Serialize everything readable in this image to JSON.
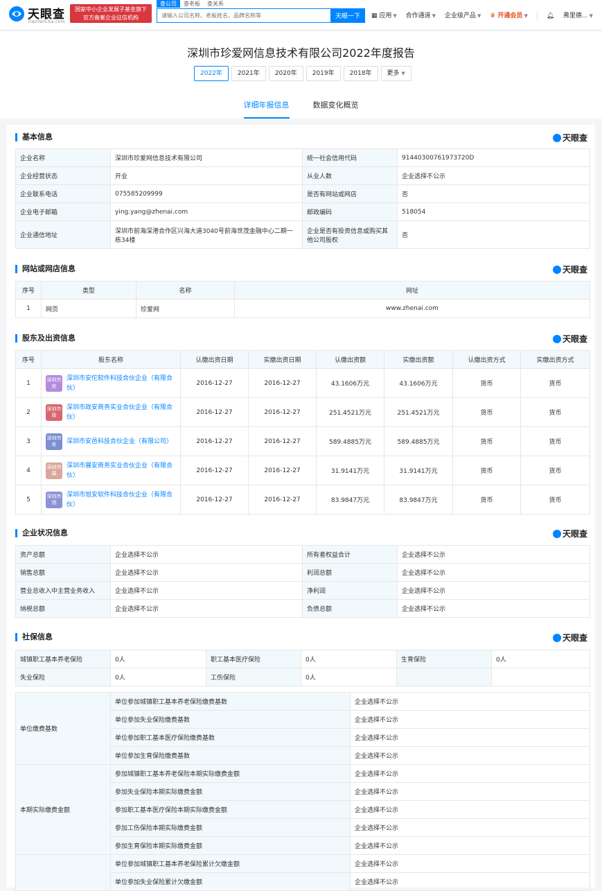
{
  "header": {
    "logo_text": "天眼查",
    "logo_sub": "TianYanCha.com",
    "badge_line1": "国家中小企业发展子基金旗下",
    "badge_line2": "官方备案企业征信机构",
    "tabs": [
      "查公司",
      "查老板",
      "查关系"
    ],
    "search_placeholder": "请输入公司名称、老板姓名、品牌名称等",
    "search_button": "天眼一下",
    "nav": [
      "应用",
      "合作通道",
      "企业级产品",
      "开通会员",
      "弗里德..."
    ]
  },
  "title": "深圳市珍爱网信息技术有限公司2022年度报告",
  "years": [
    "2022年",
    "2021年",
    "2020年",
    "2019年",
    "2018年",
    "更多"
  ],
  "subtabs": [
    "详细年报信息",
    "数据变化概览"
  ],
  "brand": "天眼查",
  "basic": {
    "title": "基本信息",
    "rows": [
      [
        "企业名称",
        "深圳市珍爱网信息技术有限公司",
        "统一社会信用代码",
        "91440300761973720D"
      ],
      [
        "企业经营状态",
        "开业",
        "从业人数",
        "企业选择不公示"
      ],
      [
        "企业联系电话",
        "075585209999",
        "是否有网站或网店",
        "否"
      ],
      [
        "企业电子邮箱",
        "ying.yang@zhenai.com",
        "邮政编码",
        "518054"
      ],
      [
        "企业通信地址",
        "深圳市前海深港合作区兴海大道3040号前海世茂金融中心二期一栋34楼",
        "企业是否有投资信息或购买其他公司股权",
        "否"
      ]
    ]
  },
  "website": {
    "title": "网站或网店信息",
    "headers": [
      "序号",
      "类型",
      "名称",
      "网址"
    ],
    "rows": [
      [
        "1",
        "网页",
        "珍爱网",
        "www.zhenai.com"
      ]
    ]
  },
  "shareholders": {
    "title": "股东及出资信息",
    "headers": [
      "序号",
      "股东名称",
      "认缴出资日期",
      "实缴出资日期",
      "认缴出资额",
      "实缴出资额",
      "认缴出资方式",
      "实缴出资方式"
    ],
    "rows": [
      {
        "no": "1",
        "avatar": "深圳市安",
        "avatar_color": "#b58be0",
        "name": "深圳市安佗软件科技合伙企业（有限合伙）",
        "d1": "2016-12-27",
        "d2": "2016-12-27",
        "a1": "43.1606万元",
        "a2": "43.1606万元",
        "m1": "货币",
        "m2": "货币"
      },
      {
        "no": "2",
        "avatar": "深圳市政",
        "avatar_color": "#d9666e",
        "name": "深圳市政安商务实业合伙企业（有限合伙）",
        "d1": "2016-12-27",
        "d2": "2016-12-27",
        "a1": "251.4521万元",
        "a2": "251.4521万元",
        "m1": "货币",
        "m2": "货币"
      },
      {
        "no": "3",
        "avatar": "深圳市安",
        "avatar_color": "#7b8fd1",
        "name": "深圳市安邑科技合伙企业（有限公司）",
        "d1": "2016-12-27",
        "d2": "2016-12-27",
        "a1": "589.4885万元",
        "a2": "589.4885万元",
        "m1": "货币",
        "m2": "货币"
      },
      {
        "no": "4",
        "avatar": "深圳市展",
        "avatar_color": "#d9a89a",
        "name": "深圳市展安商务实业合伙企业（有限合伙）",
        "d1": "2016-12-27",
        "d2": "2016-12-27",
        "a1": "31.9141万元",
        "a2": "31.9141万元",
        "m1": "货币",
        "m2": "货币"
      },
      {
        "no": "5",
        "avatar": "深圳市旭",
        "avatar_color": "#8b93d6",
        "name": "深圳市旭安软件科技合伙企业（有限合伙）",
        "d1": "2016-12-27",
        "d2": "2016-12-27",
        "a1": "83.9847万元",
        "a2": "83.9847万元",
        "m1": "货币",
        "m2": "货币"
      }
    ]
  },
  "status": {
    "title": "企业状况信息",
    "rows": [
      [
        "资产总额",
        "企业选择不公示",
        "所有者权益合计",
        "企业选择不公示"
      ],
      [
        "销售总额",
        "企业选择不公示",
        "利润总额",
        "企业选择不公示"
      ],
      [
        "营业总收入中主营业务收入",
        "企业选择不公示",
        "净利润",
        "企业选择不公示"
      ],
      [
        "纳税总额",
        "企业选择不公示",
        "负债总额",
        "企业选择不公示"
      ]
    ]
  },
  "social": {
    "title": "社保信息",
    "summary": [
      [
        "城镇职工基本养老保险",
        "0人",
        "职工基本医疗保险",
        "0人",
        "生育保险",
        "0人"
      ],
      [
        "失业保险",
        "0人",
        "工伤保险",
        "0人",
        "",
        ""
      ]
    ],
    "groups": [
      {
        "label": "单位缴费基数",
        "items": [
          [
            "单位参加城镇职工基本养老保险缴费基数",
            "企业选择不公示"
          ],
          [
            "单位参加失业保险缴费基数",
            "企业选择不公示"
          ],
          [
            "单位参加职工基本医疗保险缴费基数",
            "企业选择不公示"
          ],
          [
            "单位参加生育保险缴费基数",
            "企业选择不公示"
          ]
        ]
      },
      {
        "label": "本期实际缴费金额",
        "items": [
          [
            "参加城镇职工基本养老保险本期实际缴费金额",
            "企业选择不公示"
          ],
          [
            "参加失业保险本期实际缴费金额",
            "企业选择不公示"
          ],
          [
            "参加职工基本医疗保险本期实际缴费金额",
            "企业选择不公示"
          ],
          [
            "参加工伤保险本期实际缴费金额",
            "企业选择不公示"
          ],
          [
            "参加生育保险本期实际缴费金额",
            "企业选择不公示"
          ]
        ]
      },
      {
        "label": "",
        "items": [
          [
            "单位参加城镇职工基本养老保险累计欠缴金额",
            "企业选择不公示"
          ],
          [
            "单位参加失业保险累计欠缴金额",
            "企业选择不公示"
          ]
        ]
      }
    ]
  }
}
